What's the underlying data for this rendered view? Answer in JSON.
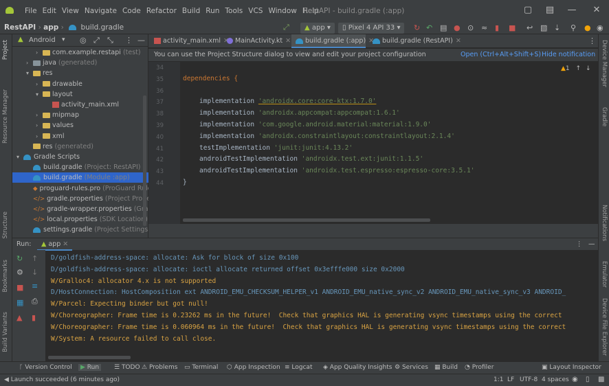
{
  "menu": {
    "items": [
      "File",
      "Edit",
      "View",
      "Navigate",
      "Code",
      "Refactor",
      "Build",
      "Run",
      "Tools",
      "VCS",
      "Window",
      "Help"
    ],
    "title": "RestAPI - build.gradle (:app)"
  },
  "navbar": {
    "crumb1": "RestAPI",
    "crumb2": "app",
    "crumb3": "build.gradle",
    "run_config": "app",
    "device": "Pixel 4 API 33"
  },
  "project": {
    "view_label": "Android",
    "tree": [
      {
        "label": "com.example.restapi",
        "suffix": "(test)",
        "indent": 2,
        "icon": "folder",
        "arrow": ">"
      },
      {
        "label": "java",
        "suffix": "(generated)",
        "indent": 1,
        "icon": "folder-blue",
        "arrow": ">"
      },
      {
        "label": "res",
        "suffix": "",
        "indent": 1,
        "icon": "folder-res",
        "arrow": "v"
      },
      {
        "label": "drawable",
        "suffix": "",
        "indent": 2,
        "icon": "folder",
        "arrow": ">"
      },
      {
        "label": "layout",
        "suffix": "",
        "indent": 2,
        "icon": "folder",
        "arrow": "v"
      },
      {
        "label": "activity_main.xml",
        "suffix": "",
        "indent": 3,
        "icon": "xml",
        "arrow": ""
      },
      {
        "label": "mipmap",
        "suffix": "",
        "indent": 2,
        "icon": "folder",
        "arrow": ">"
      },
      {
        "label": "values",
        "suffix": "",
        "indent": 2,
        "icon": "folder",
        "arrow": ">"
      },
      {
        "label": "xml",
        "suffix": "",
        "indent": 2,
        "icon": "folder",
        "arrow": ">"
      },
      {
        "label": "res",
        "suffix": "(generated)",
        "indent": 1,
        "icon": "folder-res",
        "arrow": ""
      },
      {
        "label": "Gradle Scripts",
        "suffix": "",
        "indent": 0,
        "icon": "gradle",
        "arrow": "v"
      },
      {
        "label": "build.gradle",
        "suffix": "(Project: RestAPI)",
        "indent": 1,
        "icon": "gradle",
        "arrow": ""
      },
      {
        "label": "build.gradle",
        "suffix": "(Module :app)",
        "indent": 1,
        "icon": "gradle",
        "arrow": "",
        "selected": true
      },
      {
        "label": "proguard-rules.pro",
        "suffix": "(ProGuard Rules",
        "indent": 1,
        "icon": "pro",
        "arrow": ""
      },
      {
        "label": "gradle.properties",
        "suffix": "(Project Properties",
        "indent": 1,
        "icon": "props",
        "arrow": ""
      },
      {
        "label": "gradle-wrapper.properties",
        "suffix": "(Gradle W",
        "indent": 1,
        "icon": "props",
        "arrow": ""
      },
      {
        "label": "local.properties",
        "suffix": "(SDK Location)",
        "indent": 1,
        "icon": "props",
        "arrow": ""
      },
      {
        "label": "settings.gradle",
        "suffix": "(Project Settings)",
        "indent": 1,
        "icon": "gradle",
        "arrow": ""
      }
    ]
  },
  "tabs": [
    {
      "label": "activity_main.xml",
      "icon": "xml"
    },
    {
      "label": "MainActivity.kt",
      "icon": "kt"
    },
    {
      "label": "build.gradle (:app)",
      "icon": "gradle",
      "active": true
    },
    {
      "label": "build.gradle (RestAPI)",
      "icon": "gradle"
    }
  ],
  "banner": {
    "message": "You can use the Project Structure dialog to view and edit your project configuration",
    "open_link": "Open (Ctrl+Alt+Shift+S)",
    "hide_link": "Hide notification"
  },
  "editor": {
    "warnings": "1",
    "lines": [
      {
        "no": "34",
        "code": ""
      },
      {
        "no": "35",
        "code": "dependencies {",
        "type": "block"
      },
      {
        "no": "36",
        "code": ""
      },
      {
        "no": "37",
        "kw": "implementation",
        "str": "'androidx.core:core-ktx:1.7.0'",
        "underline": true
      },
      {
        "no": "38",
        "kw": "implementation",
        "str": "'androidx.appcompat:appcompat:1.6.1'"
      },
      {
        "no": "39",
        "kw": "implementation",
        "str": "'com.google.android.material:material:1.9.0'"
      },
      {
        "no": "40",
        "kw": "implementation",
        "str": "'androidx.constraintlayout:constraintlayout:2.1.4'"
      },
      {
        "no": "41",
        "kw": "testImplementation",
        "str": "'junit:junit:4.13.2'"
      },
      {
        "no": "42",
        "kw": "androidTestImplementation",
        "str": "'androidx.test.ext:junit:1.1.5'"
      },
      {
        "no": "43",
        "kw": "androidTestImplementation",
        "str": "'androidx.test.espresso:espresso-core:3.5.1'"
      },
      {
        "no": "44",
        "code": "}",
        "type": "close"
      }
    ]
  },
  "run": {
    "label": "Run:",
    "tab": "app",
    "logs": [
      {
        "text": "D/goldfish-address-space: allocate: Ask for block of size 0x100",
        "level": "D"
      },
      {
        "text": "D/goldfish-address-space: allocate: ioctl allocate returned offset 0x3efffe000 size 0x2000",
        "level": "D"
      },
      {
        "text": "W/Gralloc4: allocator 4.x is not supported",
        "level": "W"
      },
      {
        "text": "D/HostConnection: HostComposition ext ANDROID_EMU_CHECKSUM_HELPER_v1 ANDROID_EMU_native_sync_v2 ANDROID_EMU_native_sync_v3 ANDROID_",
        "level": "D"
      },
      {
        "text": "W/Parcel: Expecting binder but got null!",
        "level": "W"
      },
      {
        "text": "W/Choreographer: Frame time is 0.23262 ms in the future!  Check that graphics HAL is generating vsync timestamps using the correct",
        "level": "W"
      },
      {
        "text": "W/Choreographer: Frame time is 0.060964 ms in the future!  Check that graphics HAL is generating vsync timestamps using the correct",
        "level": "W"
      },
      {
        "text": "W/System: A resource failed to call close.",
        "level": "W"
      }
    ]
  },
  "toolwindows": [
    "Version Control",
    "Run",
    "TODO",
    "Problems",
    "Terminal",
    "App Inspection",
    "Logcat",
    "App Quality Insights",
    "Services",
    "Build",
    "Profiler",
    "Layout Inspector"
  ],
  "left_strip": [
    "Project",
    "Resource Manager",
    "Structure",
    "Bookmarks",
    "Build Variants"
  ],
  "right_strip": [
    "Device Manager",
    "Gradle",
    "Notifications",
    "Emulator",
    "Device File Explorer"
  ],
  "status": {
    "message": "Launch succeeded (6 minutes ago)",
    "position": "1:1",
    "line_sep": "LF",
    "encoding": "UTF-8",
    "indent": "4 spaces"
  },
  "colors": {
    "accent": "#4a88c7",
    "keyword": "#cc7832",
    "string": "#6a8759",
    "warn_log": "#d9a343",
    "debug_log": "#6897bb"
  }
}
